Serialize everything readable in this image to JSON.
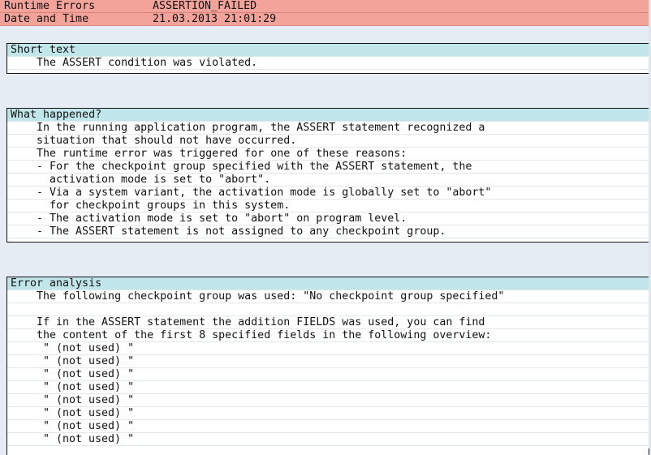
{
  "header": {
    "rows": [
      {
        "label": "Runtime Errors",
        "value": "ASSERTION_FAILED"
      },
      {
        "label": "Date and Time",
        "value": "21.03.2013 21:01:29"
      }
    ]
  },
  "short_text": {
    "title": "Short text",
    "lines": [
      "The ASSERT condition was violated."
    ]
  },
  "what_happened": {
    "title": "What happened?",
    "lines": [
      {
        "text": "In the running application program, the ASSERT statement recognized a",
        "indent": 0
      },
      {
        "text": "situation that should not have occurred.",
        "indent": 0
      },
      {
        "text": "The runtime error was triggered for one of these reasons:",
        "indent": 0
      },
      {
        "text": "- For the checkpoint group specified with the ASSERT statement, the",
        "indent": 0
      },
      {
        "text": "activation mode is set to \"abort\".",
        "indent": 1
      },
      {
        "text": "- Via a system variant, the activation mode is globally set to \"abort\"",
        "indent": 0
      },
      {
        "text": "for checkpoint groups in this system.",
        "indent": 1
      },
      {
        "text": "- The activation mode is set to \"abort\" on program level.",
        "indent": 0
      },
      {
        "text": "- The ASSERT statement is not assigned to any checkpoint group.",
        "indent": 0
      }
    ]
  },
  "error_analysis": {
    "title": "Error analysis",
    "lines": [
      "The following checkpoint group was used: \"No checkpoint group specified\"",
      "",
      "If in the ASSERT statement the addition FIELDS was used, you can find",
      "the content of the first 8 specified fields in the following overview:",
      "\" (not used) \"",
      "\" (not used) \"",
      "\" (not used) \"",
      "\" (not used) \"",
      "\" (not used) \"",
      "\" (not used) \"",
      "\" (not used) \"",
      "\" (not used) \""
    ]
  }
}
